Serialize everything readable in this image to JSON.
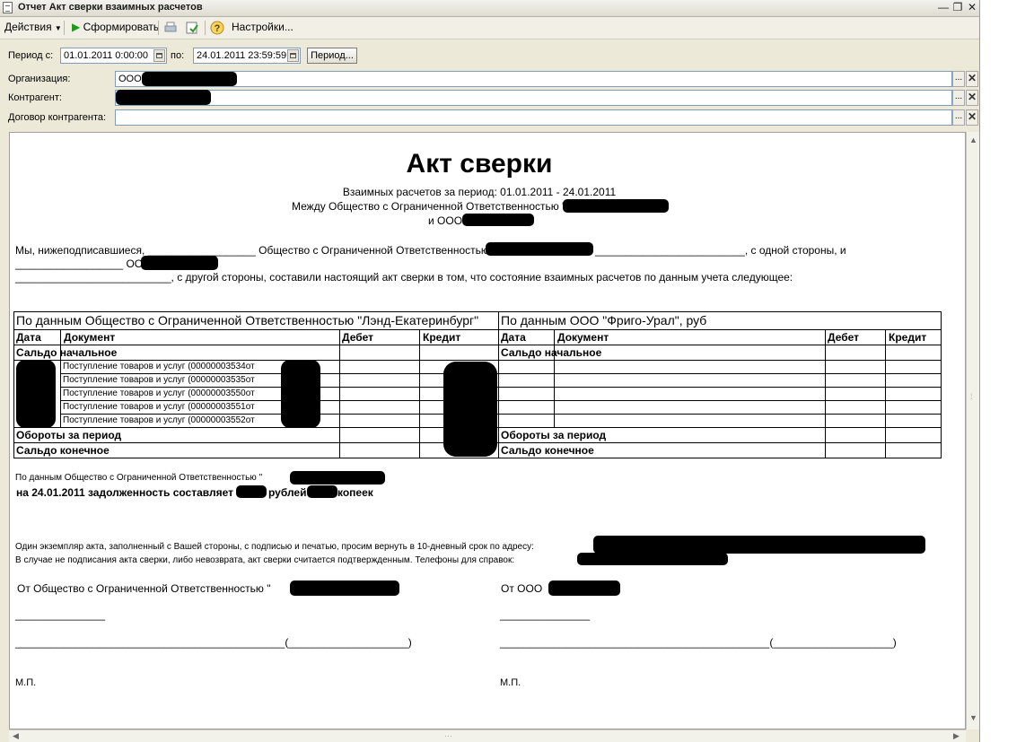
{
  "window": {
    "title": "Отчет  Акт сверки взаимных расчетов"
  },
  "toolbar": {
    "actions_label": "Действия",
    "generate_label": "Сформировать",
    "settings_label": "Настройки..."
  },
  "period": {
    "from_label": "Период с:",
    "from_value": "01.01.2011  0:00:00",
    "to_label": "по:",
    "to_value": "24.01.2011 23:59:59",
    "period_button": "Период..."
  },
  "filters": {
    "org_label": "Организация:",
    "org_value": "ООО \"",
    "counterparty_label": "Контрагент:",
    "contract_label": "Договор контрагента:"
  },
  "report": {
    "title": "Акт сверки",
    "subtitle1": "Взаимных расчетов за период: 01.01.2011 - 24.01.2011",
    "subtitle2": "Между Общество с Ограниченной Ответственностью \"",
    "subtitle3": "и ООО",
    "para1a": "Мы, нижеподписавшиеся, __________________ Общество с Ограниченной Ответственностью",
    "para1b": "_________________________, с одной стороны, и",
    "para1c": "__________________ ООО",
    "para2": "__________________________, с другой стороны, составили настоящий акт сверки в том, что состояние взаимных расчетов по данным учета следующее:",
    "table": {
      "left_header": "По данным Общество с Ограниченной Ответственностью \"Лэнд-Екатеринбург\"",
      "right_header": "По данным ООО \"Фриго-Урал\", руб",
      "col_date": "Дата",
      "col_doc": "Документ",
      "col_debit": "Дебет",
      "col_credit": "Кредит",
      "opening": "Сальдо начальное",
      "turnover": "Обороты за период",
      "closing": "Сальдо конечное",
      "rows": [
        "Поступление товаров и услуг (00000003534от",
        "Поступление товаров и услуг (00000003535от",
        "Поступление товаров и услуг (00000003550от",
        "Поступление товаров и услуг (00000003551от",
        "Поступление товаров и услуг (00000003552от"
      ]
    },
    "debt_line1": "По данным Общество с Ограниченной Ответственностью \"",
    "debt_line2a": "на 24.01.2011 задолженность составляет",
    "debt_line2b": "рублей",
    "debt_line2c": "копеек",
    "note1": "Один экземпляр  акта, заполненный с Вашей стороны, с подписью и печатью, просим вернуть в 10-дневный срок по адресу:",
    "note2": "В случае не подписания акта сверки, либо невозврата, акт сверки считается подтвержденным. Телефоны для справок:",
    "sign_left": "От Общество с Ограниченной Ответственностью \"",
    "sign_right": "От ООО",
    "sign_short_line": "_______________",
    "sign_long_line": "_____________________________________________(____________________)",
    "stamp": "М.П."
  }
}
